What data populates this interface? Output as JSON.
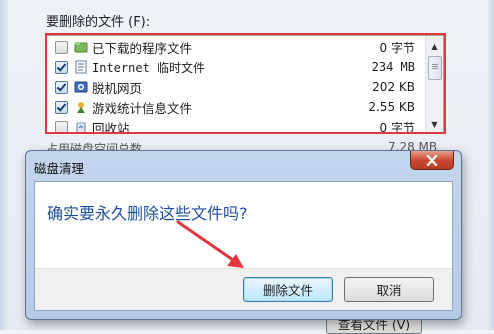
{
  "background": {
    "files_label": "要删除的文件 (F):",
    "files": [
      {
        "name": "已下载的程序文件",
        "size": "0 字节",
        "checked": false,
        "icon": "folder-icon"
      },
      {
        "name": "Internet 临时文件",
        "size": "234 MB",
        "checked": true,
        "icon": "document-icon"
      },
      {
        "name": "脱机网页",
        "size": "202 KB",
        "checked": true,
        "icon": "web-page-icon"
      },
      {
        "name": "游戏统计信息文件",
        "size": "2.55 KB",
        "checked": true,
        "icon": "game-icon"
      },
      {
        "name": "回收站",
        "size": "0 字节",
        "checked": false,
        "icon": "recycle-bin-icon"
      }
    ],
    "hidden_row_label": "占用磁盘空间总数",
    "hidden_row_size": "7.28 MB",
    "view_files_button": "查看文件 (V)"
  },
  "dialog": {
    "title": "磁盘清理",
    "message": "确实要永久删除这些文件吗?",
    "confirm_button": "删除文件",
    "cancel_button": "取消"
  },
  "colors": {
    "highlight_box": "#e0383c",
    "message_text": "#1e4fa3",
    "close_button": "#c7462e"
  }
}
